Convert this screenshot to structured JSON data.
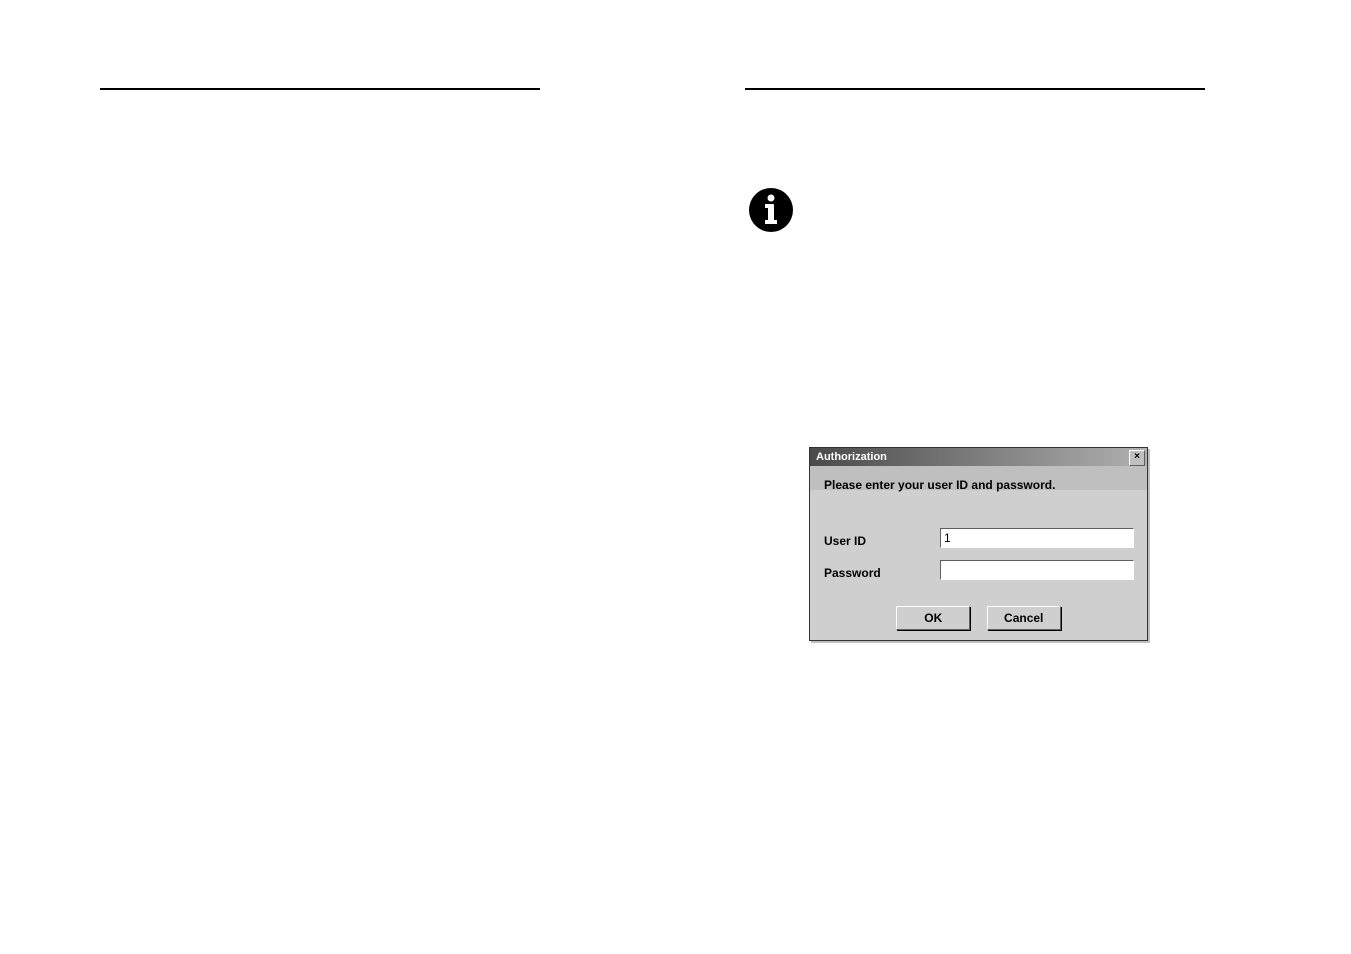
{
  "dialog": {
    "title": "Authorization",
    "prompt": "Please enter your user ID and password.",
    "close_glyph": "×",
    "fields": {
      "user_id_label": "User ID",
      "user_id_value": "1",
      "password_label": "Password",
      "password_value": ""
    },
    "buttons": {
      "ok_label": "OK",
      "cancel_label": "Cancel"
    }
  },
  "icons": {
    "info": "info-icon"
  }
}
